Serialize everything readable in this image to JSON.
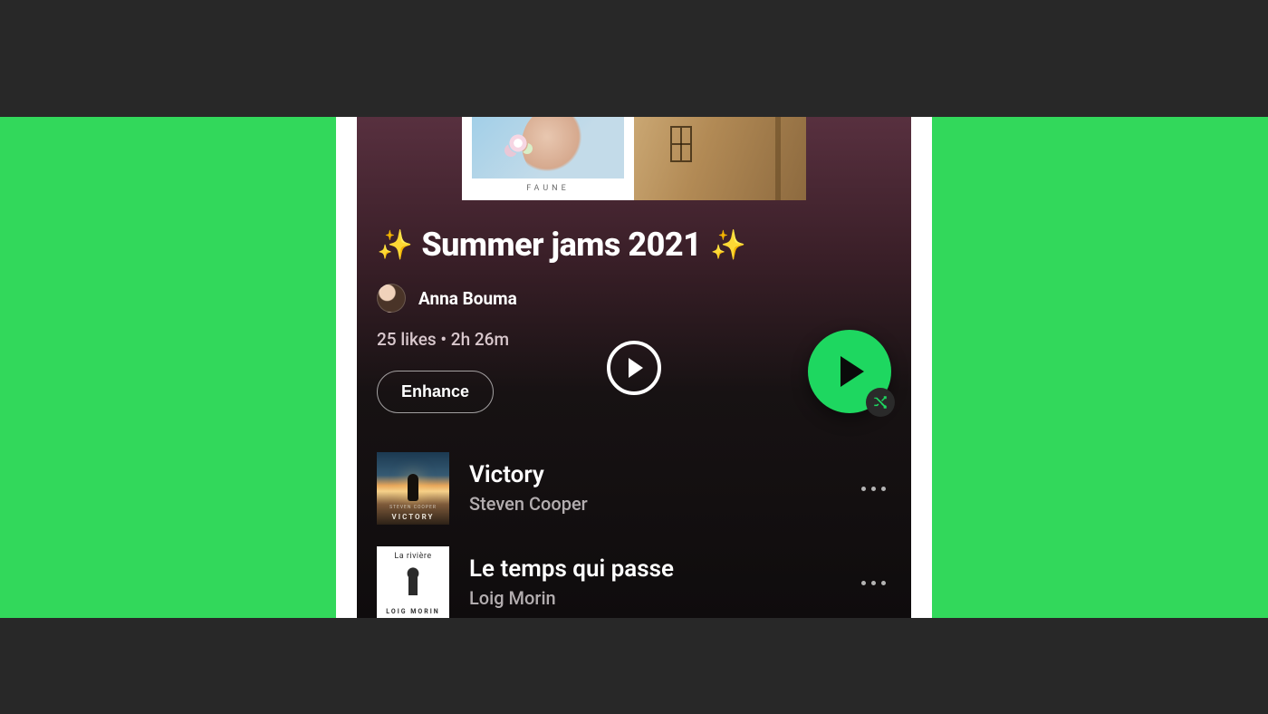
{
  "colors": {
    "page_bg": "#282828",
    "band_green": "#32d85b",
    "play_green": "#1ed760",
    "text_primary": "#ffffff",
    "text_muted": "#b3adaf"
  },
  "cover_art": {
    "left_caption": "FAUNE"
  },
  "playlist": {
    "sparkle": "✨",
    "title": "Summer jams 2021",
    "owner": "Anna Bouma",
    "stats": "25 likes • 2h 26m",
    "enhance_label": "Enhance"
  },
  "icons": {
    "play": "play-icon",
    "shuffle": "shuffle-icon",
    "more": "more-icon"
  },
  "tracks": [
    {
      "title": "Victory",
      "artist": "Steven Cooper",
      "art_top": "STEVEN COOPER",
      "art_bottom": "VICTORY"
    },
    {
      "title": "Le temps qui passe",
      "artist": "Loig Morin",
      "art_top": "La rivière",
      "art_bottom": "LOIG MORIN"
    }
  ]
}
